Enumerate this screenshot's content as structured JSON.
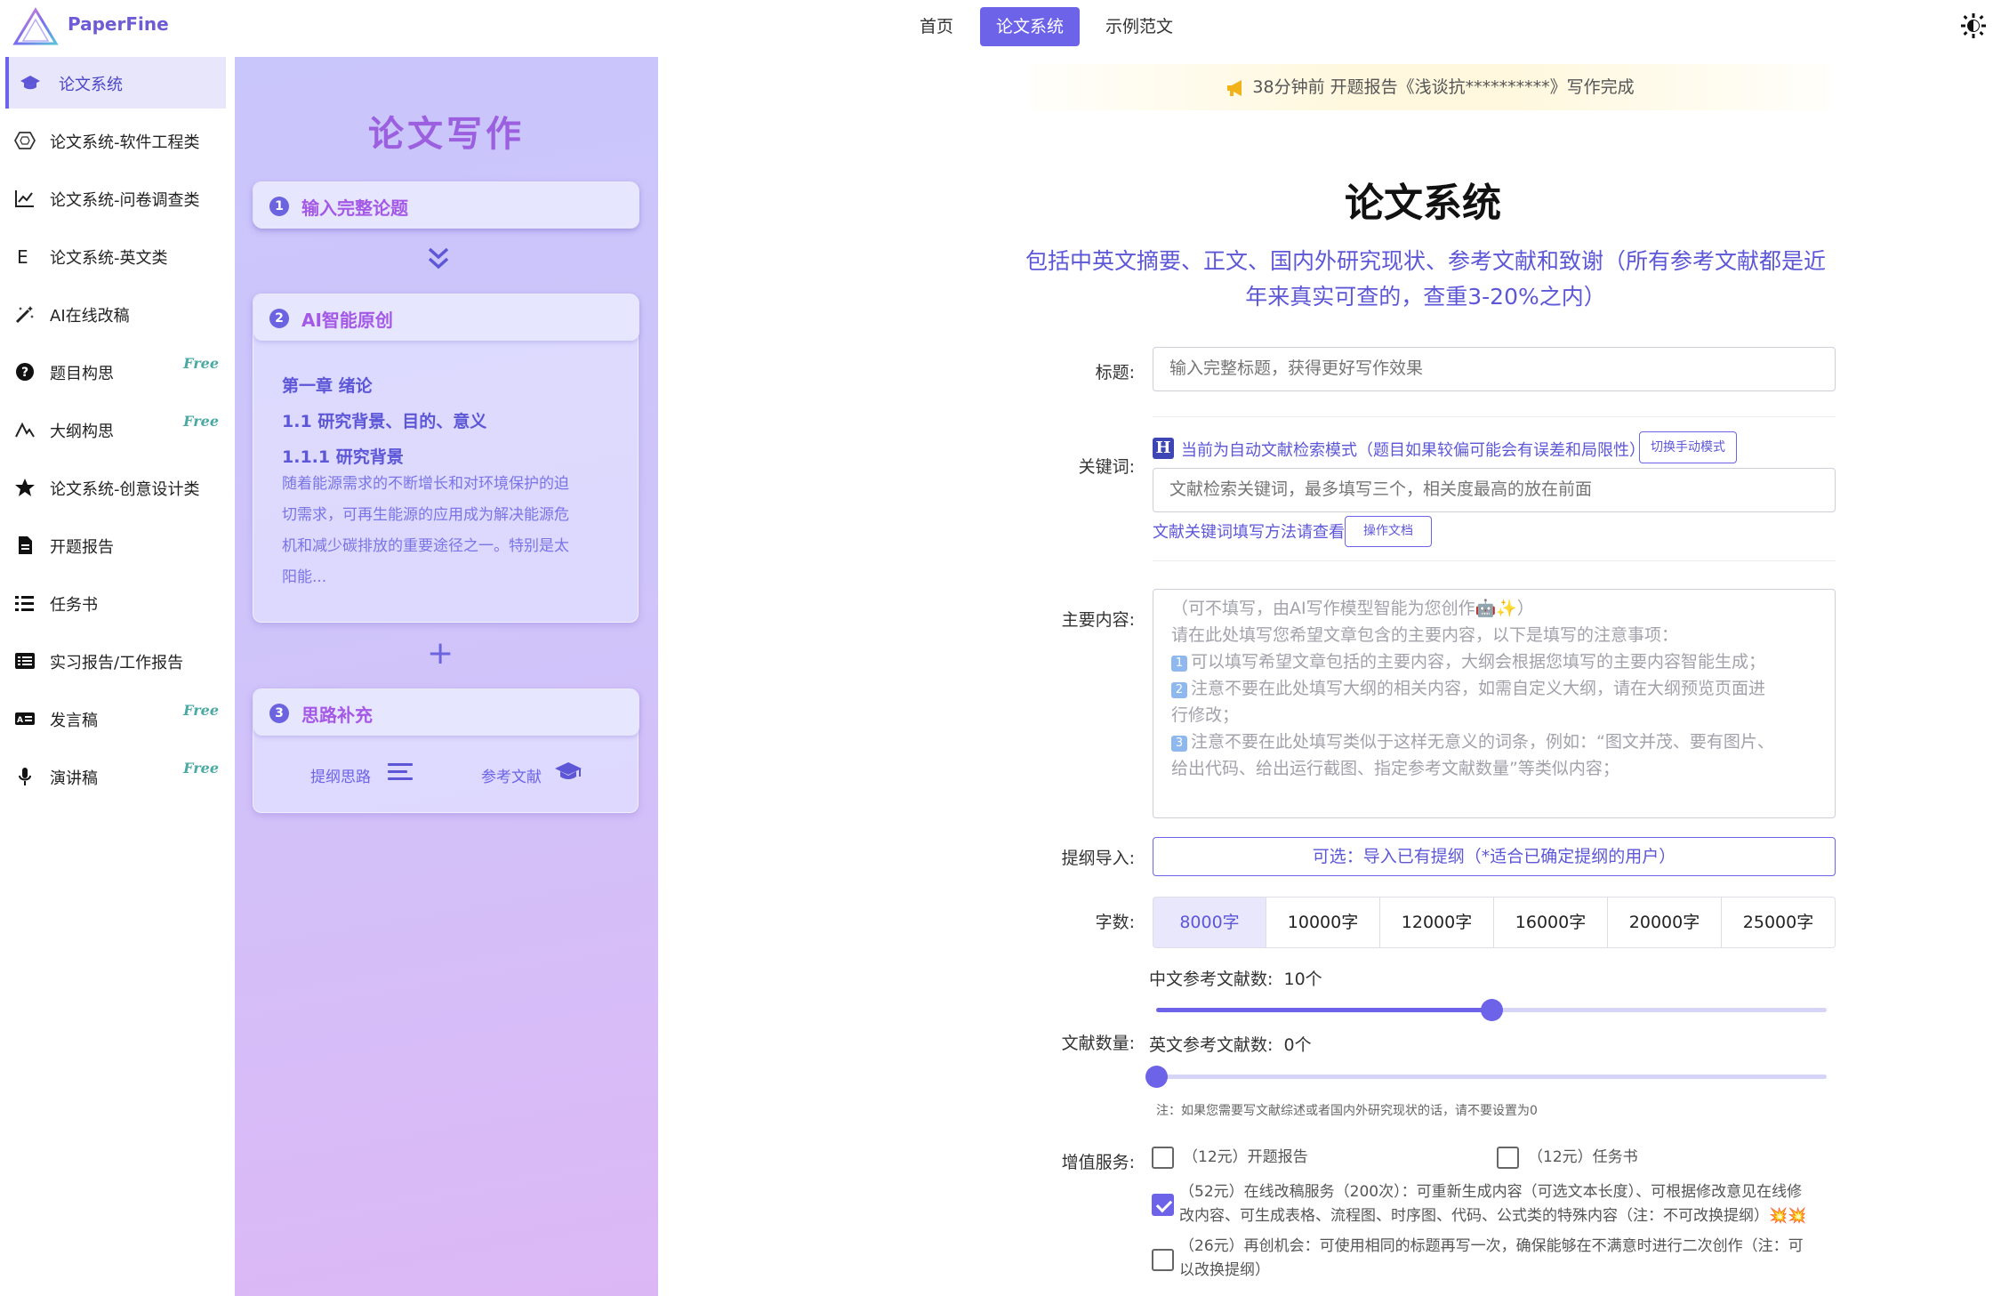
{
  "app": {
    "name": "PaperFine"
  },
  "nav": {
    "items": [
      {
        "label": "首页",
        "active": false
      },
      {
        "label": "论文系统",
        "active": true
      },
      {
        "label": "示例范文",
        "active": false
      }
    ]
  },
  "sidebar": {
    "items": [
      {
        "label": "论文系统",
        "icon": "graduation-cap-icon",
        "active": true,
        "free": ""
      },
      {
        "label": "论文系统-软件工程类",
        "icon": "hexagon-icon",
        "active": false,
        "free": ""
      },
      {
        "label": "论文系统-问卷调查类",
        "icon": "line-chart-icon",
        "active": false,
        "free": ""
      },
      {
        "label": "论文系统-英文类",
        "icon": "letter-e-icon",
        "active": false,
        "free": ""
      },
      {
        "label": "AI在线改稿",
        "icon": "magic-wand-icon",
        "active": false,
        "free": ""
      },
      {
        "label": "题目构思",
        "icon": "question-circle-icon",
        "active": false,
        "free": "Free"
      },
      {
        "label": "大纲构思",
        "icon": "outline-icon",
        "active": false,
        "free": "Free"
      },
      {
        "label": "论文系统-创意设计类",
        "icon": "star-icon",
        "active": false,
        "free": ""
      },
      {
        "label": "开题报告",
        "icon": "document-icon",
        "active": false,
        "free": ""
      },
      {
        "label": "任务书",
        "icon": "task-list-icon",
        "active": false,
        "free": ""
      },
      {
        "label": "实习报告/工作报告",
        "icon": "list-box-icon",
        "active": false,
        "free": ""
      },
      {
        "label": "发言稿",
        "icon": "id-card-icon",
        "active": false,
        "free": "Free"
      },
      {
        "label": "演讲稿",
        "icon": "microphone-icon",
        "active": false,
        "free": "Free"
      }
    ]
  },
  "promo": {
    "title": "论文写作",
    "step1": {
      "num": "1",
      "label": "输入完整论题"
    },
    "step2": {
      "num": "2",
      "label": "AI智能原创",
      "h_chapter": "第一章 绪论",
      "h_section": "1.1 研究背景、目的、意义",
      "h_sub": "1.1.1 研究背景",
      "p1": "随着能源需求的不断增长和对环境保护的迫",
      "p2": "切需求，可再生能源的应用成为解决能源危",
      "p3": "机和减少碳排放的重要途径之一。特别是太",
      "p4": "阳能..."
    },
    "step3": {
      "num": "3",
      "label": "思路补充",
      "btn_outline": "提纲思路",
      "btn_refs": "参考文献"
    }
  },
  "notice": {
    "text": "38分钟前 开题报告《浅谈抗**********》写作完成"
  },
  "main": {
    "title": "论文系统",
    "subtitle_line1": "包括中英文摘要、正文、国内外研究现状、参考文献和致谢（所有参考文献都是近",
    "subtitle_line2": "年来真实可查的，查重3-20%之内）"
  },
  "form": {
    "title_label": "标题:",
    "title_placeholder": "输入完整标题，获得更好写作效果",
    "keywords_label": "关键词:",
    "mode_badge": "H",
    "mode_text": "当前为自动文献检索模式（题目如果较偏可能会有误差和局限性）",
    "switch_mode_btn": "切换手动模式",
    "keywords_placeholder": "文献检索关键词，最多填写三个，相关度最高的放在前面",
    "keywords_help": "文献关键词填写方法请查看",
    "docs_btn": "操作文档",
    "content_label": "主要内容:",
    "content_lines": [
      "（可不填写，由AI写作模型智能为您创作🤖✨）",
      "请在此处填写您希望文章包含的主要内容，以下是填写的注意事项：",
      "可以填写希望文章包括的主要内容，大纲会根据您填写的主要内容智能生成；",
      "注意不要在此处填写大纲的相关内容，如需自定义大纲，请在大纲预览页面进",
      "行修改；",
      "注意不要在此处填写类似于这样无意义的词条，例如：“图文并茂、要有图片、",
      "给出代码、给出运行截图、指定参考文献数量”等类似内容；"
    ],
    "content_badges": [
      "1",
      "2",
      "3"
    ],
    "outline_label": "提纲导入:",
    "outline_btn": "可选：导入已有提纲（*适合已确定提纲的用户）",
    "words_label": "字数:",
    "word_options": [
      "8000字",
      "10000字",
      "12000字",
      "16000字",
      "20000字",
      "25000字"
    ],
    "word_selected": 0,
    "refs_label": "文献数量:",
    "cn_refs_label": "中文参考文献数:",
    "cn_refs_value": "10个",
    "cn_refs_fraction": 0.5,
    "en_refs_label": "英文参考文献数:",
    "en_refs_value": "0个",
    "en_refs_fraction": 0.0,
    "refs_note": "注：如果您需要写文献综述或者国内外研究现状的话，请不要设置为0",
    "services_label": "增值服务:",
    "svc1": "（12元）开题报告",
    "svc2": "（12元）任务书",
    "svc3_line1": "（52元）在线改稿服务（200次）：可重新生成内容（可选文本长度）、可根据修改意见在线修",
    "svc3_line2": "改内容、可生成表格、流程图、时序图、代码、公式类的特殊内容（注：不可改换提纲）💥💥",
    "svc4_line1": "（26元）再创机会：可使用相同的标题再写一次，确保能够在不满意时进行二次创作（注：可",
    "svc4_line2": "以改换提纲）",
    "svc_checked": [
      false,
      false,
      true,
      false
    ]
  },
  "colors": {
    "accent": "#6c63e8",
    "promo_title": "#9b5fe0",
    "free": "#4aa9a3"
  }
}
